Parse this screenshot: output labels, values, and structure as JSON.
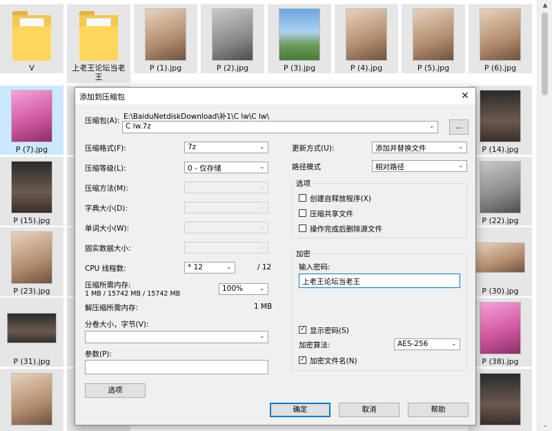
{
  "explorer": {
    "tiles": [
      {
        "label": "V"
      },
      {
        "label": "上老王论坛当老王"
      },
      {
        "label": "P (1).jpg"
      },
      {
        "label": "P (2).jpg"
      },
      {
        "label": "P (3).jpg"
      },
      {
        "label": "P (4).jpg"
      },
      {
        "label": "P (5).jpg"
      },
      {
        "label": "P (6).jpg"
      },
      {
        "label": "P (7).jpg"
      },
      {
        "label": "P (14).jpg"
      },
      {
        "label": "P (15).jpg"
      },
      {
        "label": "P (22).jpg"
      },
      {
        "label": "P (23).jpg"
      },
      {
        "label": "P (30).jpg"
      },
      {
        "label": "P (31).jpg"
      },
      {
        "label": "P (38).jpg"
      }
    ]
  },
  "scrollbar": {
    "up_glyph": "▲",
    "down_glyph": "⌄"
  },
  "dialog": {
    "title": "添加到压缩包",
    "close_glyph": "✕",
    "archive": {
      "label": "压缩包(A):",
      "path": "E:\\BaiduNetdiskDownload\\补1\\C lw\\C lw\\",
      "value": "C lw.7z",
      "browse_label": "..."
    },
    "left": {
      "format_label": "压缩格式(F):",
      "format_value": "7z",
      "level_label": "压缩等级(L):",
      "level_value": "0 - 仅存储",
      "method_label": "压缩方法(M):",
      "dict_label": "字典大小(D):",
      "word_label": "单词大小(W):",
      "solid_label": "固实数据大小:",
      "cpu_label": "CPU 线程数:",
      "cpu_value": "* 12",
      "cpu_total": "/ 12",
      "mem_label": "压缩所需内存:",
      "mem_detail": "1 MB / 15742 MB / 15742 MB",
      "mem_value": "100%",
      "decomp_label": "解压缩所需内存:",
      "decomp_value": "1 MB",
      "split_label": "分卷大小，字节(V):",
      "split_value": "",
      "params_label": "参数(P):",
      "params_value": "",
      "options_button": "选项"
    },
    "right": {
      "update_label": "更新方式(U):",
      "update_value": "添加并替换文件",
      "pathmode_label": "路径模式",
      "pathmode_value": "相对路径",
      "options_group": "选项",
      "opt_sfx": "创建自释放程序(X)",
      "opt_shared": "压缩共享文件",
      "opt_delete": "操作完成后删除源文件",
      "encrypt_group": "加密",
      "password_label": "输入密码:",
      "password_value": "上老王论坛当老王",
      "show_password": "显示密码(S)",
      "show_password_checked": "✓",
      "method_label": "加密算法:",
      "method_value": "AES-256",
      "encrypt_names": "加密文件名(N)",
      "encrypt_names_checked": "✓"
    },
    "buttons": {
      "ok": "确定",
      "cancel": "取消",
      "help": "帮助"
    }
  }
}
